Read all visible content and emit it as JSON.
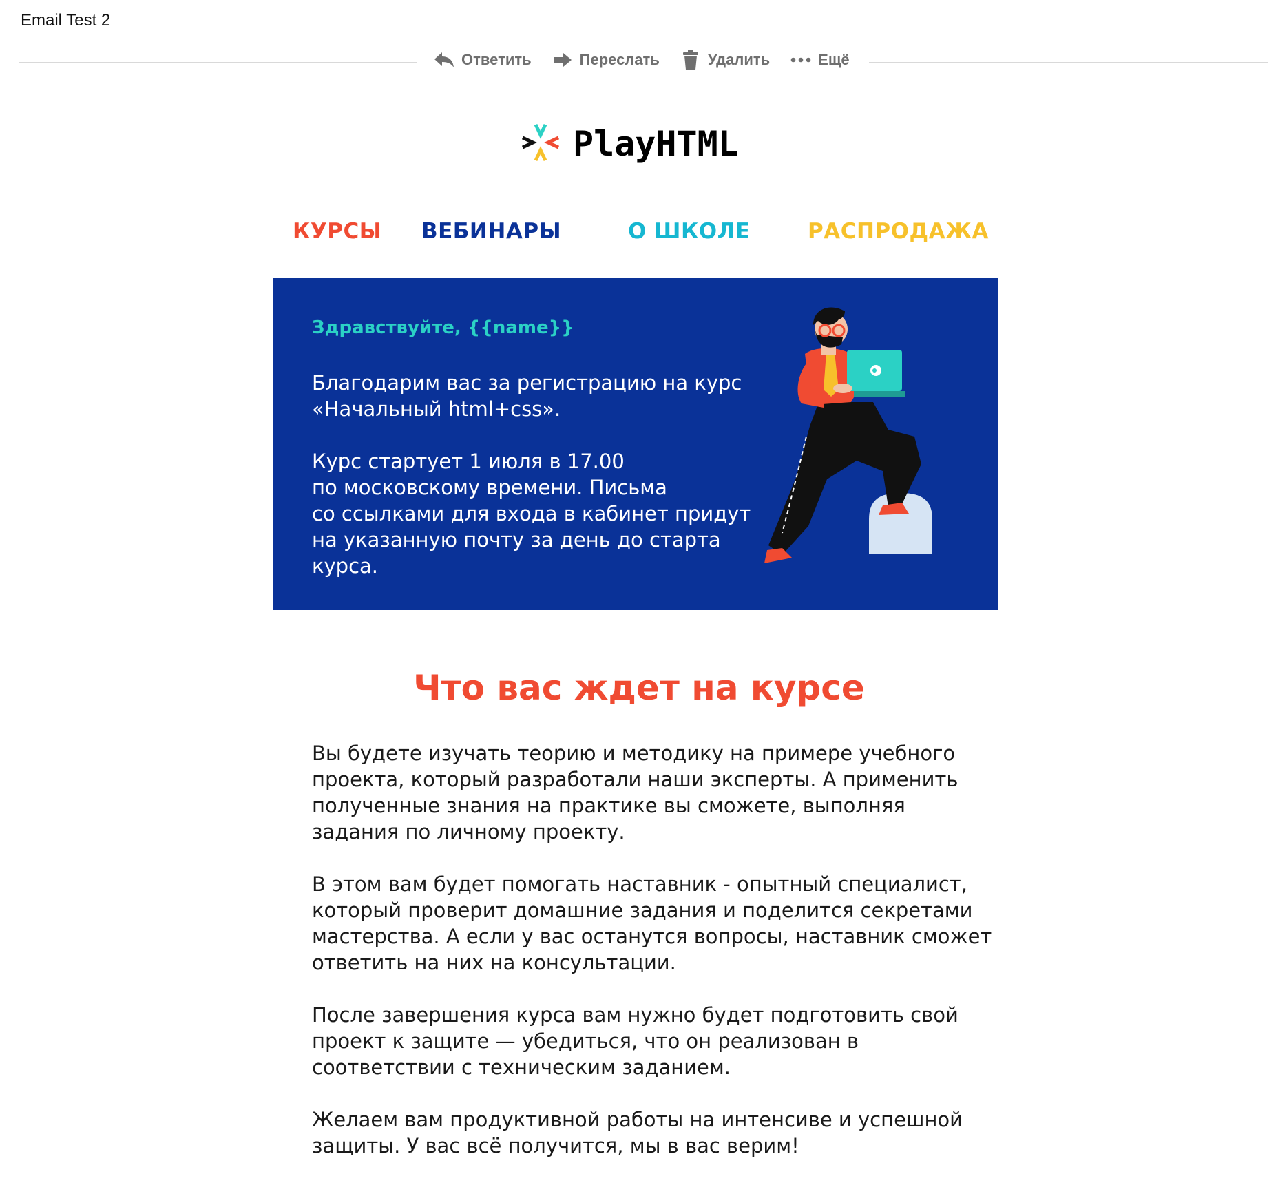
{
  "email": {
    "subject": "Email Test 2"
  },
  "toolbar": {
    "reply_label": "Ответить",
    "forward_label": "Переслать",
    "delete_label": "Удалить",
    "more_label": "Ещё",
    "icon_color": "#6f6f6f"
  },
  "brand": {
    "name": "PlayHTML"
  },
  "nav": {
    "items": [
      {
        "label": "КУРСЫ",
        "color": "#f04b32"
      },
      {
        "label": "ВЕБИНАРЫ",
        "color": "#0a3298"
      },
      {
        "label": "О ШКОЛЕ",
        "color": "#16b7d1"
      },
      {
        "label": "РАСПРОДАЖА",
        "color": "#f7c12b"
      }
    ]
  },
  "hero": {
    "greeting": "Здравствуйте, {{name}}",
    "paragraphs": [
      "Благодарим вас за регистрацию на курс\n«Начальный html+css».",
      "Курс стартует 1 июля в 17.00\nпо московскому времени. Письма\nсо ссылками для входа в кабинет придут\nна указанную почту за день до старта\nкурса."
    ],
    "background": "#0a3298",
    "accent": "#2bd1c5"
  },
  "section": {
    "title": "Что вас ждет на курсе",
    "paragraphs": [
      "Вы будете изучать теорию и методику на примере учебного\nпроекта, который разработали наши эксперты. А применить\nполученные знания на практике вы сможете, выполняя\nзадания по личному проекту.",
      "В этом вам будет помогать наставник - опытный специалист,\nкоторый проверит домашние задания и поделится секретами\nмастерства. А если у вас останутся вопросы, наставник сможет\nответить на них на консультации.",
      "После завершения курса вам нужно будет подготовить свой\nпроект к защите — убедиться, что он реализован в\nсоответствии с техническим заданием.",
      "Желаем вам продуктивной работы на интенсиве и успешной\nзащиты. У вас всё получится, мы в вас верим!"
    ]
  }
}
